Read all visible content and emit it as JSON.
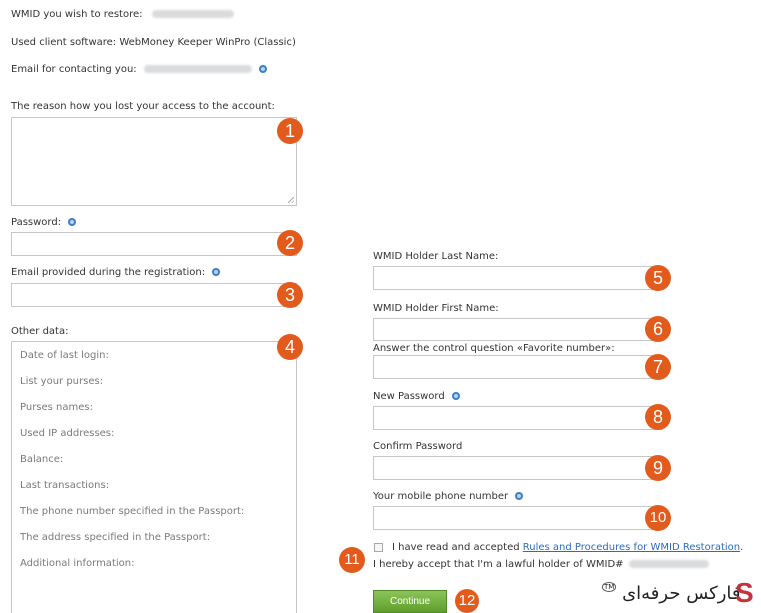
{
  "header": {
    "wmid_label": "WMID you wish to restore:",
    "software_label": "Used client software: WebMoney Keeper WinPro (Classic)",
    "email_contact_label": "Email for contacting you:"
  },
  "left_form": {
    "reason_label": "The reason how you lost your access to the account:",
    "password_label": "Password:",
    "email_registration_label": "Email provided during the registration:",
    "other_data_label": "Other data:",
    "other_data_items": [
      "Date of last login:",
      "List your purses:",
      "Purses names:",
      "Used IP addresses:",
      "Balance:",
      "Last transactions:",
      "The phone number specified in the Passport:",
      "The address specified in the Passport:",
      "Additional information:"
    ]
  },
  "right_form": {
    "last_name_label": "WMID Holder Last Name:",
    "first_name_label": "WMID Holder First Name:",
    "control_question_label": "Answer the control question «Favorite number»:",
    "new_password_label": "New Password",
    "confirm_password_label": "Confirm Password",
    "mobile_label": "Your mobile phone number"
  },
  "agreement": {
    "prefix": "I have read and accepted",
    "link": "Rules and Procedures for WMID Restoration",
    "suffix": ".",
    "holder_text": "I hereby accept that I'm a lawful holder of WMID#"
  },
  "continue_label": "Continue",
  "badges": [
    "1",
    "2",
    "3",
    "4",
    "5",
    "6",
    "7",
    "8",
    "9",
    "10",
    "11",
    "12"
  ],
  "watermark": {
    "text": "فارکس حرفه‌ای",
    "mark": "TM"
  },
  "colors": {
    "badge": "#e35b1c",
    "button": "#6aaa34",
    "link": "#2a6cc0",
    "info_icon": "#3b7fc4"
  }
}
